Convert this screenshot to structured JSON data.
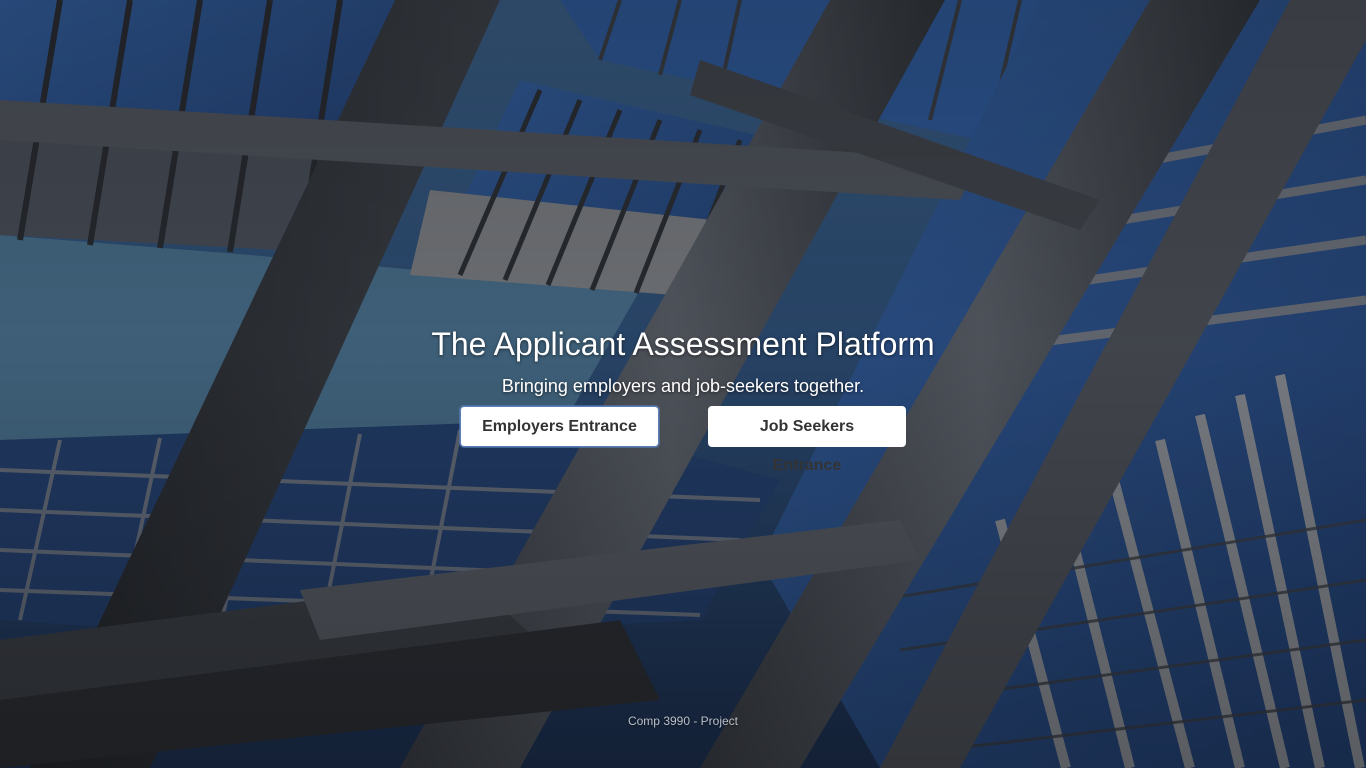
{
  "hero": {
    "title": "The Applicant Assessment Platform",
    "subtitle": "Bringing employers and job-seekers together.",
    "buttons": {
      "employers_label": "Employers Entrance",
      "seekers_label": "Job Seekers Entrance"
    }
  },
  "footer": {
    "text": "Comp 3990 - Project"
  },
  "colors": {
    "sky_blue": "#3a5f86",
    "steel_gray": "#6b7079",
    "glass_blue": "#2f5a9a",
    "button_bg": "#ffffff",
    "button_text": "#333333",
    "focus_ring": "#5b7fb8"
  }
}
